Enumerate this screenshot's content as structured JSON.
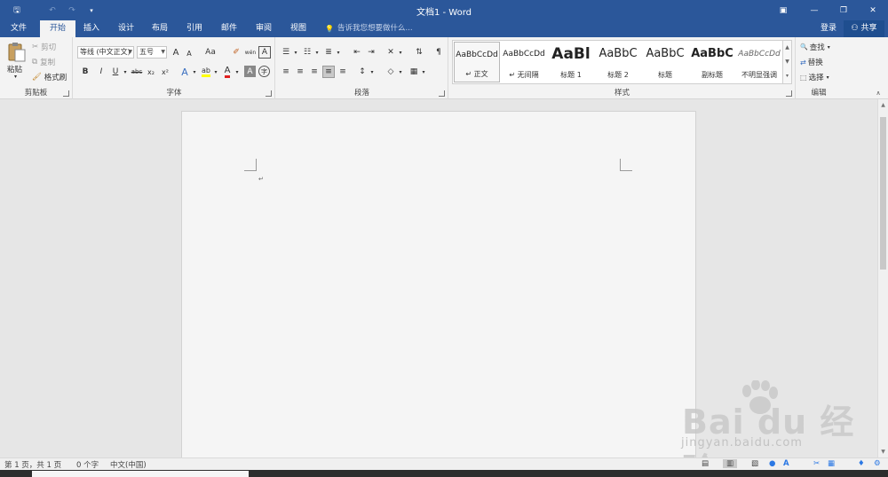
{
  "titlebar": {
    "title": "文档1 - Word",
    "qat": [
      {
        "name": "save-icon",
        "glyph": "🖫"
      },
      {
        "name": "undo-icon",
        "glyph": "↶"
      },
      {
        "name": "redo-icon",
        "glyph": "↷"
      },
      {
        "name": "customize-qat-icon",
        "glyph": "▾"
      }
    ],
    "controls": {
      "ribbon_options_glyph": "▣",
      "minimize_glyph": "—",
      "restore_glyph": "❐",
      "close_glyph": "✕"
    },
    "bg_color": "#2b579a"
  },
  "tabs": {
    "file": "文件",
    "home": "开始",
    "insert": "插入",
    "design": "设计",
    "layout": "布局",
    "references": "引用",
    "mailings": "邮件",
    "review": "审阅",
    "view": "视图",
    "tell_me": "告诉我您想要做什么...",
    "tell_me_glyph": "💡",
    "sign_in": "登录",
    "share": "共享",
    "share_glyph": "⚇"
  },
  "ribbon": {
    "clipboard": {
      "label": "剪贴板",
      "paste": "粘贴",
      "paste_arrow": "▾",
      "cut": "剪切",
      "copy": "复制",
      "format_painter": "格式刷"
    },
    "font": {
      "label": "字体",
      "font_name": "等线 (中文正文)",
      "font_size": "五号",
      "grow_glyph": "A",
      "shrink_glyph": "A",
      "change_case": "Aa",
      "clear_format_glyph": "✐",
      "phonetic_glyph": "wén",
      "border_char_glyph": "A",
      "bold": "B",
      "italic": "I",
      "underline": "U",
      "strikethrough": "abc",
      "subscript": "x₂",
      "superscript": "x²",
      "text_effects": "A",
      "highlight": "ab",
      "font_color": "A",
      "shading_glyph": "A",
      "enclose_glyph": "字",
      "highlight_color": "#ffff00",
      "font_color_color": "#e02020"
    },
    "paragraph": {
      "label": "段落",
      "bullets_glyph": "☰",
      "numbering_glyph": "☷",
      "multilevel_glyph": "≣",
      "decrease_indent_glyph": "⇤",
      "increase_indent_glyph": "⇥",
      "chinese_layout_glyph": "✕",
      "sort_glyph": "⇅",
      "show_marks_glyph": "¶",
      "align_left_glyph": "≡",
      "align_center_glyph": "≡",
      "align_right_glyph": "≡",
      "justify_glyph": "≡",
      "distributed_glyph": "≡",
      "line_spacing_glyph": "↕",
      "shading_glyph": "◇",
      "borders_glyph": "▦"
    },
    "styles": {
      "label": "样式",
      "items": [
        {
          "sample": "AaBbCcDd",
          "name": "正文",
          "mark": "↵"
        },
        {
          "sample": "AaBbCcDd",
          "name": "无间隔",
          "mark": "↵"
        },
        {
          "sample": "AaBl",
          "name": "标题 1"
        },
        {
          "sample": "AaBbC",
          "name": "标题 2"
        },
        {
          "sample": "AaBbC",
          "name": "标题"
        },
        {
          "sample": "AaBbC",
          "name": "副标题"
        },
        {
          "sample": "AaBbCcDd",
          "name": "不明显强调"
        }
      ],
      "scroll_up": "▲",
      "scroll_down": "▼",
      "more": "▾"
    },
    "editing": {
      "label": "编辑",
      "find": "查找",
      "replace": "替换",
      "select": "选择",
      "find_glyph": "🔍",
      "replace_glyph": "⇄",
      "select_glyph": "⬚"
    }
  },
  "document": {
    "paragraph_mark": "↵"
  },
  "scrollbar": {
    "up": "▲",
    "down": "▼"
  },
  "statusbar": {
    "page": "第 1 页，共 1 页",
    "words": "0 个字",
    "language": "中文(中国)",
    "read_mode_glyph": "▤",
    "print_layout_glyph": "▥",
    "web_layout_glyph": "▧",
    "tray_icons": [
      "●",
      "A",
      "✂",
      "▦",
      "♦",
      "⚙"
    ]
  },
  "watermark": {
    "main": "Bai du 经验",
    "sub": "jingyan.baidu.com"
  }
}
